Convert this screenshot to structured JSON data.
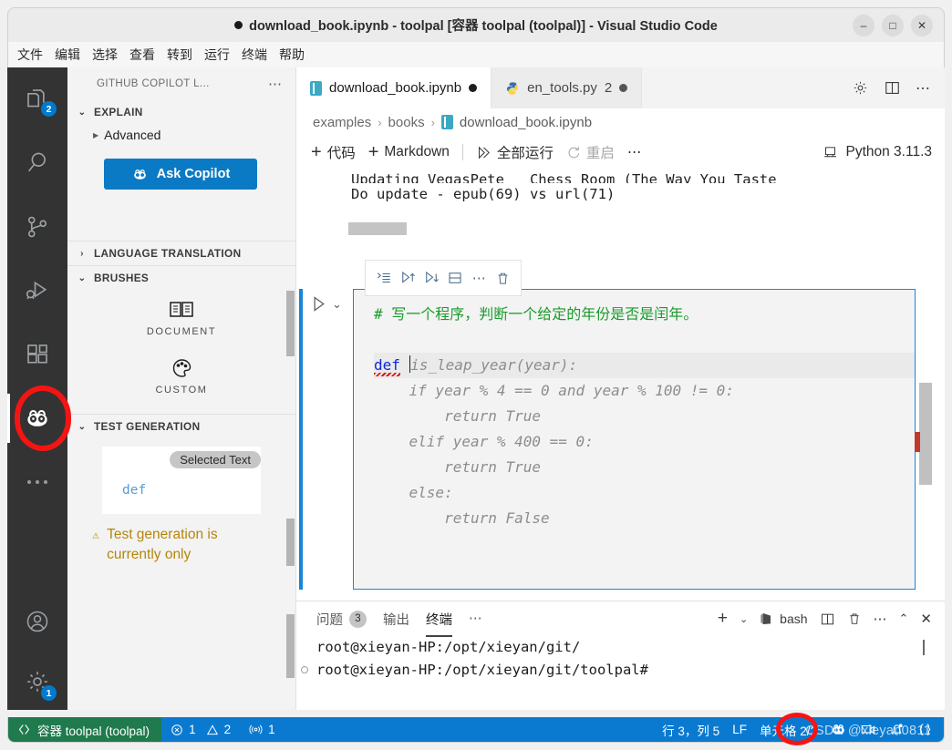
{
  "window": {
    "title": "download_book.ipynb - toolpal [容器 toolpal (toolpal)] - Visual Studio Code",
    "minimize": "–",
    "maximize": "□",
    "close": "✕"
  },
  "menubar": {
    "items": [
      "文件",
      "编辑",
      "选择",
      "查看",
      "转到",
      "运行",
      "终端",
      "帮助"
    ]
  },
  "activitybar": {
    "items": [
      {
        "name": "explorer",
        "badge": "2"
      },
      {
        "name": "search",
        "badge": ""
      },
      {
        "name": "source-control",
        "badge": ""
      },
      {
        "name": "run-and-debug",
        "badge": ""
      },
      {
        "name": "extensions",
        "badge": ""
      },
      {
        "name": "github-copilot-labs",
        "badge": ""
      }
    ],
    "more": "…",
    "accounts_badge": "",
    "settings_badge": "1"
  },
  "sidebar": {
    "title": "GITHUB COPILOT L...",
    "more": "⋯",
    "sections": [
      {
        "label": "EXPLAIN",
        "expanded": true
      },
      {
        "label": "LANGUAGE TRANSLATION",
        "expanded": false
      },
      {
        "label": "BRUSHES",
        "expanded": true
      },
      {
        "label": "TEST GENERATION",
        "expanded": true
      }
    ],
    "explain": {
      "advanced_label": "Advanced",
      "ask_button": "Ask Copilot"
    },
    "brushes": [
      {
        "label": "DOCUMENT",
        "icon": "book-icon"
      },
      {
        "label": "CUSTOM",
        "icon": "palette-icon"
      }
    ],
    "test_generation": {
      "selected_badge": "Selected Text",
      "selected_code": "def",
      "warning": "Test generation is currently only"
    }
  },
  "editor": {
    "tabs": [
      {
        "label": "download_book.ipynb",
        "icon": "notebook-icon",
        "dirty": "●",
        "count": "",
        "active": true
      },
      {
        "label": "en_tools.py",
        "icon": "python-icon",
        "dirty": "●",
        "count": "2",
        "active": false
      }
    ],
    "actions": [
      "gear-icon",
      "split-editor-icon",
      "more-icon"
    ],
    "breadcrumb": [
      "examples",
      "books",
      "download_book.ipynb"
    ],
    "breadcrumb_sep": "›",
    "toolbar": {
      "add_code": "代码",
      "add_markdown": "Markdown",
      "run_all": "全部运行",
      "restart": "重启",
      "more": "⋯",
      "kernel": "Python 3.11.3",
      "plus": "+"
    },
    "previous_output": [
      "Updating VegasPete _ Chess Room (The Way You Taste",
      "Do update - epub(69) vs url(71)"
    ],
    "cell_toolbar_icons": [
      "run-by-line-icon",
      "execute-above-icon",
      "execute-below-icon",
      "split-cell-icon",
      "more-icon",
      "delete-cell-icon"
    ],
    "cell": {
      "run_icon": "▷",
      "collapse_icon": "⌄",
      "comment_line": "# 写一个程序，判断一个给定的年份是否是闰年。",
      "code_lines": [
        {
          "kw": "def",
          "rest": "is_leap_year(year):"
        },
        {
          "kw": "",
          "rest": "    if year % 4 == 0 and year % 100 != 0:"
        },
        {
          "kw": "",
          "rest": "        return True"
        },
        {
          "kw": "",
          "rest": "    elif year % 400 == 0:"
        },
        {
          "kw": "",
          "rest": "        return True"
        },
        {
          "kw": "",
          "rest": "    else:"
        },
        {
          "kw": "",
          "rest": "        return False"
        }
      ]
    }
  },
  "panel": {
    "tabs": [
      {
        "label": "问题",
        "badge": "3",
        "active": false
      },
      {
        "label": "输出",
        "badge": "",
        "active": false
      },
      {
        "label": "终端",
        "badge": "",
        "active": true
      }
    ],
    "more": "⋯",
    "new_terminal": "+",
    "dropdown": "⌄",
    "shell": "bash",
    "actions": [
      "split-terminal-icon",
      "kill-terminal-icon",
      "more-icon",
      "chevron-up-icon",
      "close-icon"
    ],
    "terminal_lines": [
      "root@xieyan-HP:/opt/xieyan/git/",
      "root@xieyan-HP:/opt/xieyan/git/toolpal#"
    ]
  },
  "statusbar": {
    "remote": "容器 toolpal (toolpal)",
    "errors": "1",
    "warnings": "2",
    "ports": "1",
    "position": "行 3，列 5",
    "eol": "LF",
    "cell": "单元格 2/2",
    "right_icons": [
      "copilot-icon",
      "screencast-icon",
      "bell-icon",
      "braces-icon"
    ],
    "watermark": "CSDN @xieyan0811",
    "colors": {
      "bar": "#0a7ad1",
      "remote": "#1f7a4d",
      "accent": "#007acc"
    }
  }
}
